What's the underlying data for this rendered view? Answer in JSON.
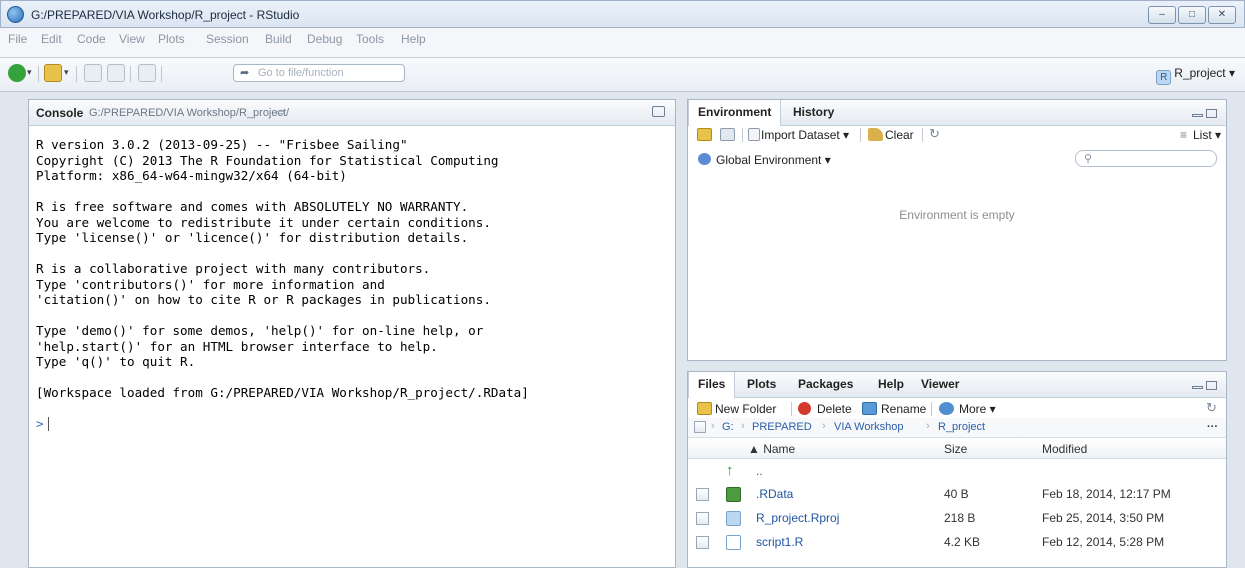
{
  "window": {
    "title": "G:/PREPARED/VIA Workshop/R_project - RStudio"
  },
  "menu": [
    "File",
    "Edit",
    "Code",
    "View",
    "Plots",
    "Session",
    "Build",
    "Debug",
    "Tools",
    "Help"
  ],
  "toolbar": {
    "goto_placeholder": "Go to file/function",
    "project_label": "R_project ▾"
  },
  "console": {
    "title": "Console",
    "path": "G:/PREPARED/VIA Workshop/R_project/",
    "lines": [
      "R version 3.0.2 (2013-09-25) -- \"Frisbee Sailing\"",
      "Copyright (C) 2013 The R Foundation for Statistical Computing",
      "Platform: x86_64-w64-mingw32/x64 (64-bit)",
      "",
      "R is free software and comes with ABSOLUTELY NO WARRANTY.",
      "You are welcome to redistribute it under certain conditions.",
      "Type 'license()' or 'licence()' for distribution details.",
      "",
      "R is a collaborative project with many contributors.",
      "Type 'contributors()' for more information and",
      "'citation()' on how to cite R or R packages in publications.",
      "",
      "Type 'demo()' for some demos, 'help()' for on-line help, or",
      "'help.start()' for an HTML browser interface to help.",
      "Type 'q()' to quit R.",
      "",
      "[Workspace loaded from G:/PREPARED/VIA Workshop/R_project/.RData]",
      ""
    ],
    "prompt": ">"
  },
  "env": {
    "tabs": [
      "Environment",
      "History"
    ],
    "import_label": "Import Dataset ▾",
    "clear_label": "Clear",
    "list_label": "List ▾",
    "scope_label": "Global Environment ▾",
    "empty_text": "Environment is empty"
  },
  "files": {
    "tabs": [
      "Files",
      "Plots",
      "Packages",
      "Help",
      "Viewer"
    ],
    "new_folder": "New Folder",
    "delete": "Delete",
    "rename": "Rename",
    "more": "More ▾",
    "crumbs": [
      "G:",
      "PREPARED",
      "VIA Workshop",
      "R_project"
    ],
    "columns": {
      "name": "▲ Name",
      "size": "Size",
      "modified": "Modified"
    },
    "parent": "..",
    "rows": [
      {
        "name": ".RData",
        "size": "40 B",
        "modified": "Feb 18, 2014, 12:17 PM"
      },
      {
        "name": "R_project.Rproj",
        "size": "218 B",
        "modified": "Feb 25, 2014, 3:50 PM"
      },
      {
        "name": "script1.R",
        "size": "4.2 KB",
        "modified": "Feb 12, 2014, 5:28 PM"
      }
    ]
  },
  "colors": {
    "accent": "#2b5ea8",
    "prompt": "#3b6fb6"
  }
}
